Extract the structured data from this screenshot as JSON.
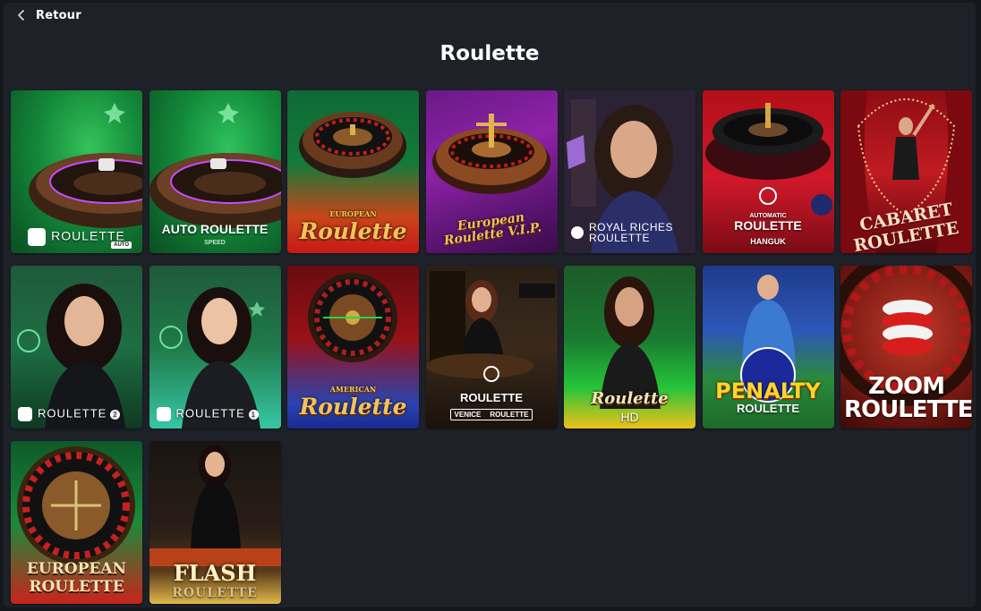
{
  "header": {
    "back_label": "Retour",
    "page_title": "Roulette"
  },
  "games": [
    {
      "title": "ROULETTE",
      "badge": "AUTO"
    },
    {
      "title": "AUTO ROULETTE",
      "subtitle": "SPEED"
    },
    {
      "title_top": "EUROPEAN",
      "title_main": "Roulette"
    },
    {
      "title": "European Roulette V.I.P."
    },
    {
      "line1": "ROYAL RICHES",
      "line2": "ROULETTE"
    },
    {
      "top": "AUTOMATIC",
      "title": "ROULETTE",
      "subtitle": "HANGUK"
    },
    {
      "line1": "CABARET",
      "line2": "ROULETTE"
    },
    {
      "title": "ROULETTE",
      "number": "2"
    },
    {
      "title": "ROULETTE",
      "number": "1"
    },
    {
      "title_top": "AMERICAN",
      "title_main": "Roulette"
    },
    {
      "title": "ROULETTE",
      "left": "VENICE",
      "right": "ROULETTE"
    },
    {
      "title_main": "Roulette",
      "subtitle": "HD"
    },
    {
      "line1": "PENALTY",
      "line2": "ROULETTE"
    },
    {
      "line1": "ZOOM",
      "line2": "ROULETTE"
    },
    {
      "line1": "EUROPEAN",
      "line2": "ROULETTE"
    },
    {
      "line1": "FLASH",
      "line2": "ROULETTE"
    }
  ]
}
